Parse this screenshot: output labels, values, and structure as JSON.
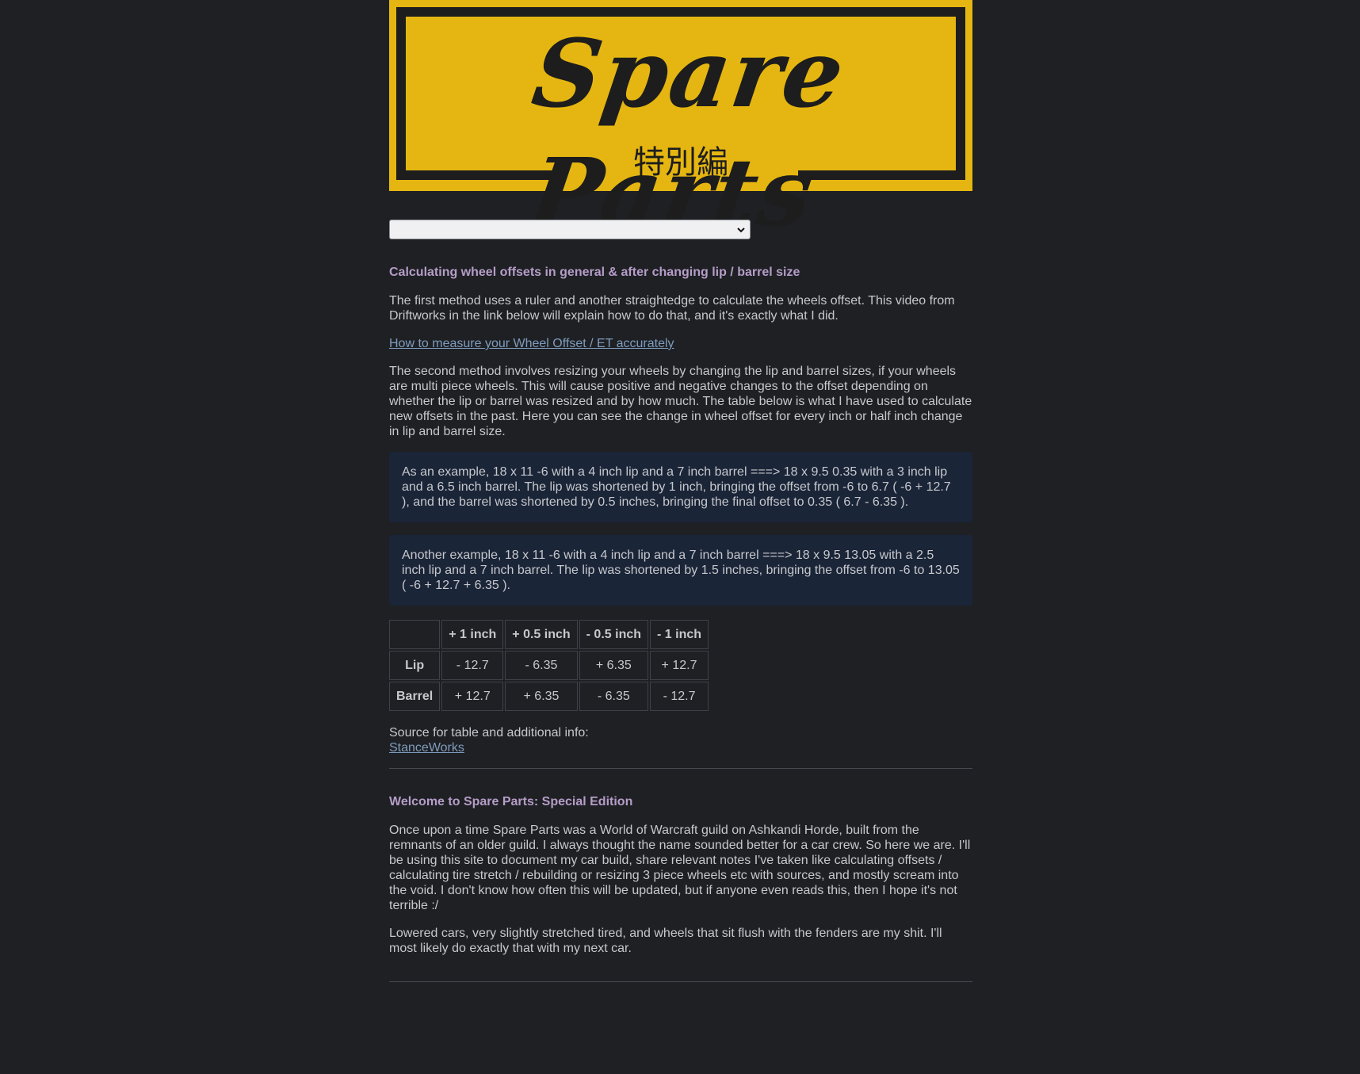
{
  "banner": {
    "title": "Spare Parts",
    "subtitle": "特別編",
    "colors": {
      "background": "#e5b611",
      "ink": "#1d1d1d"
    }
  },
  "nav_select": {
    "selected_value": "",
    "icon": "chevron-down-icon"
  },
  "offsets_article": {
    "heading": "Calculating wheel offsets in general & after changing lip / barrel size",
    "paragraph_1": "The first method uses a ruler and another straightedge to calculate the wheels offset. This video from Driftworks in the link below will explain how to do that, and it's exactly what I did.",
    "video_link": "How to measure your Wheel Offset / ET accurately",
    "paragraph_2": "The second method involves resizing your wheels by changing the lip and barrel sizes, if your wheels are multi piece wheels. This will cause positive and negative changes to the offset depending on whether the lip or barrel was resized and by how much. The table below is what I have used to calculate new offsets in the past. Here you can see the change in wheel offset for every inch or half inch change in lip and barrel size.",
    "example_1": "As an example, 18 x 11 -6 with a 4 inch lip and a 7 inch barrel ===> 18 x 9.5 0.35 with a 3 inch lip and a 6.5 inch barrel. The lip was shortened by 1 inch, bringing the offset from -6 to 6.7 ( -6 + 12.7 ), and the barrel was shortened by 0.5 inches, bringing the final offset to 0.35 ( 6.7 - 6.35 ).",
    "example_2": "Another example, 18 x 11 -6 with a 4 inch lip and a 7 inch barrel ===> 18 x 9.5 13.05 with a 2.5 inch lip and a 7 inch barrel. The lip was shortened by 1.5 inches, bringing the offset from -6 to 13.05 ( -6 + 12.7 + 6.35 ).",
    "table": {
      "columns": [
        "",
        "+ 1 inch",
        "+ 0.5 inch",
        "- 0.5 inch",
        "- 1 inch"
      ],
      "rows": [
        {
          "label": "Lip",
          "values": [
            "- 12.7",
            "- 6.35",
            "+ 6.35",
            "+ 12.7"
          ]
        },
        {
          "label": "Barrel",
          "values": [
            "+ 12.7",
            "+ 6.35",
            "- 6.35",
            "- 12.7"
          ]
        }
      ]
    },
    "source_label": "Source for table and additional info:",
    "source_link": "StanceWorks"
  },
  "welcome_article": {
    "heading": "Welcome to Spare Parts: Special Edition",
    "paragraph_1": "Once upon a time Spare Parts was a World of Warcraft guild on Ashkandi Horde, built from the remnants of an older guild. I always thought the name sounded better for a car crew. So here we are. I'll be using this site to document my car build, share relevant notes I've taken like calculating offsets / calculating tire stretch / rebuilding or resizing 3 piece wheels etc with sources, and mostly scream into the void. I don't know how often this will be updated, but if anyone even reads this, then I hope it's not terrible :/",
    "paragraph_2": "Lowered cars, very slightly stretched tired, and wheels that sit flush with the fenders are my shit. I'll most likely do exactly that with my next car."
  },
  "theme": {
    "page_background": "#1e2024",
    "heading_color": "#b69dc8",
    "link_color": "#7f9cbd",
    "callout_background": "#1b2538"
  }
}
